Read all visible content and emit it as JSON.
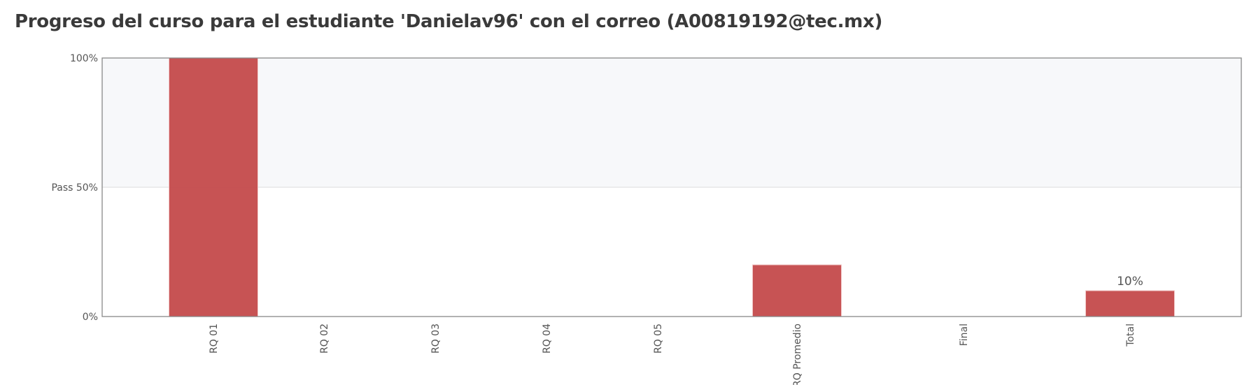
{
  "chart_data": {
    "type": "bar",
    "title": "Progreso del curso para el estudiante 'Danielav96' con el correo (A00819192@tec.mx)",
    "categories": [
      "RQ 01",
      "RQ 02",
      "RQ 03",
      "RQ 04",
      "RQ 05",
      "RQ Promedio",
      "Final",
      "Total"
    ],
    "values": [
      100,
      0,
      0,
      0,
      0,
      20,
      0,
      10
    ],
    "data_labels": {
      "Total": "10%"
    },
    "ylim": [
      0,
      100
    ],
    "yticks": [
      {
        "value": 0,
        "label": "0%"
      },
      {
        "value": 50,
        "label": "Pass 50%"
      },
      {
        "value": 100,
        "label": "100%"
      }
    ],
    "pass_threshold": 50,
    "pass_region_shaded": true,
    "xlabel": "",
    "ylabel": "",
    "colors": {
      "bar": "#c44a4b",
      "pass_region": "#f7f8fa",
      "axis": "#888888"
    }
  }
}
